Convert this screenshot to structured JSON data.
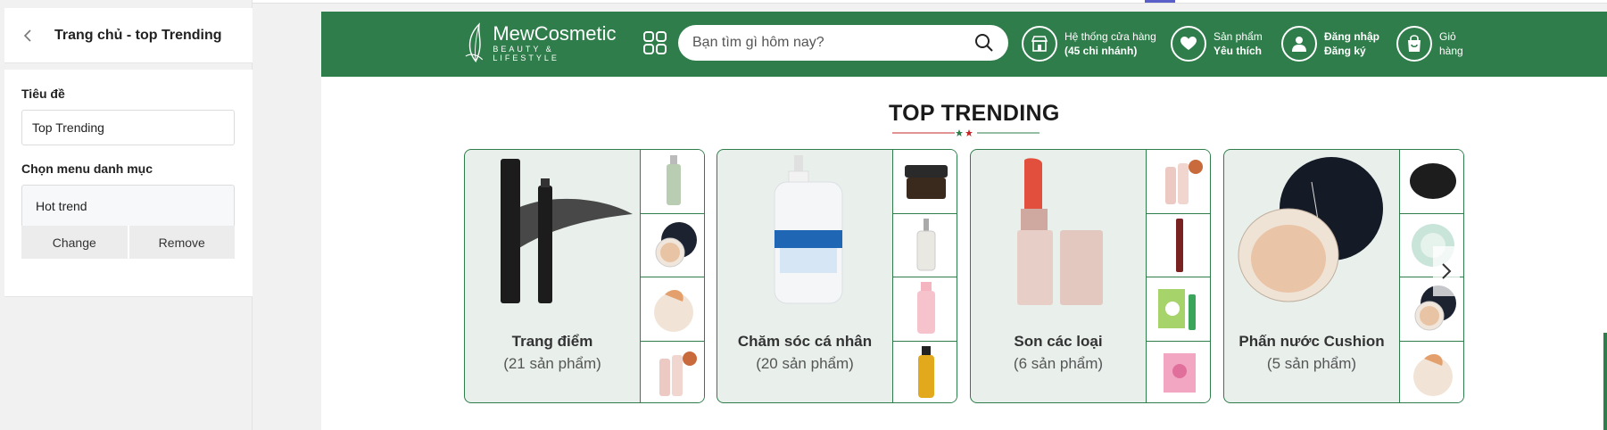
{
  "editor": {
    "title": "Trang chủ - top Trending",
    "heading_label": "Tiêu đề",
    "heading_value": "Top Trending",
    "menu_label": "Chọn menu danh mục",
    "menu_value": "Hot trend",
    "change_label": "Change",
    "remove_label": "Remove"
  },
  "site": {
    "logo_name": "MewCosmetic",
    "logo_sub": "BEAUTY & LIFESTYLE",
    "search_placeholder": "Bạn tìm gì hôm nay?",
    "stores_line1": "Hệ thống cửa hàng",
    "stores_line2": "(45 chi nhánh)",
    "fav_line1": "Sản phẩm",
    "fav_line2": "Yêu thích",
    "login_line1": "Đăng nhập",
    "login_line2": "Đăng ký",
    "cart_line1": "Giỏ",
    "cart_line2": "hàng",
    "accent_color": "#2e7d4a"
  },
  "section": {
    "title": "TOP TRENDING"
  },
  "categories": [
    {
      "name": "Trang điểm",
      "count": "(21 sản phẩm)"
    },
    {
      "name": "Chăm sóc cá nhân",
      "count": "(20 sản phẩm)"
    },
    {
      "name": "Son các loại",
      "count": "(6 sản phẩm)"
    },
    {
      "name": "Phấn nước Cushion",
      "count": "(5 sản phẩm)"
    }
  ]
}
